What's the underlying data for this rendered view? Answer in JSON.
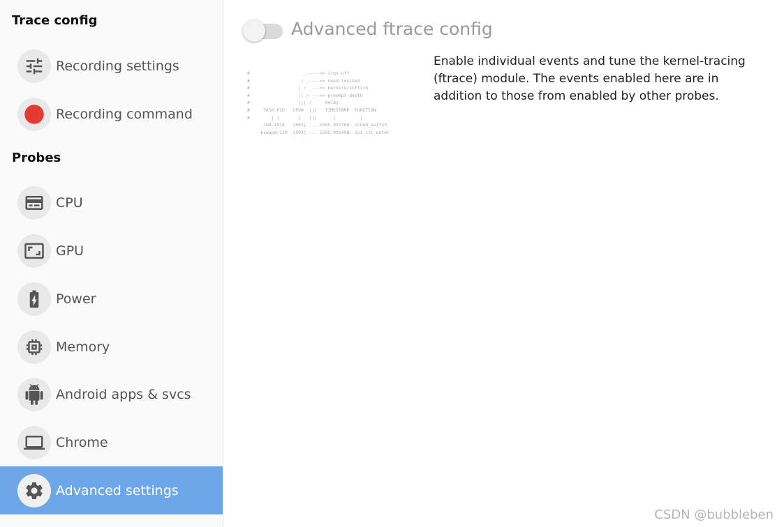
{
  "sidebar": {
    "trace_config_header": "Trace config",
    "trace_config_items": [
      {
        "label": "Recording settings",
        "icon": "tune-sliders-icon"
      },
      {
        "label": "Recording command",
        "icon": "record-dot-icon"
      }
    ],
    "probes_header": "Probes",
    "probe_items": [
      {
        "label": "CPU",
        "icon": "cpu-icon"
      },
      {
        "label": "GPU",
        "icon": "gpu-icon"
      },
      {
        "label": "Power",
        "icon": "battery-icon"
      },
      {
        "label": "Memory",
        "icon": "memory-chip-icon"
      },
      {
        "label": "Android apps & svcs",
        "icon": "android-icon"
      },
      {
        "label": "Chrome",
        "icon": "laptop-icon"
      },
      {
        "label": "Advanced settings",
        "icon": "gear-icon",
        "active": true
      }
    ]
  },
  "main": {
    "toggle_on": false,
    "section_title": "Advanced ftrace config",
    "description": "Enable individual events and tune the kernel-tracing (ftrace) module. The events enabled here are in addition to those from enabled by other probes.",
    "ascii_art": "#                    _-----=> irqs-off\n#                   / _----=> need-resched\n#                  | / _---=> hardirq/softirq\n#                  || / _--=> preempt-depth\n#                  ||| /     delay\n#     TASK-PID   CPU#  |||   TIMESTAMP  FUNCTION\n#        | |       |   |||      |         |\n      cmd-1914   [003] ... 1505.991706: sched_switch\n     kswapd-110  [002] ... 1505.991408: spi_ctl_enter"
  },
  "colors": {
    "active_bg": "#6ea6ea",
    "record_red": "#e53935",
    "icon_gray": "#555555"
  },
  "watermark": "CSDN @bubbleben"
}
